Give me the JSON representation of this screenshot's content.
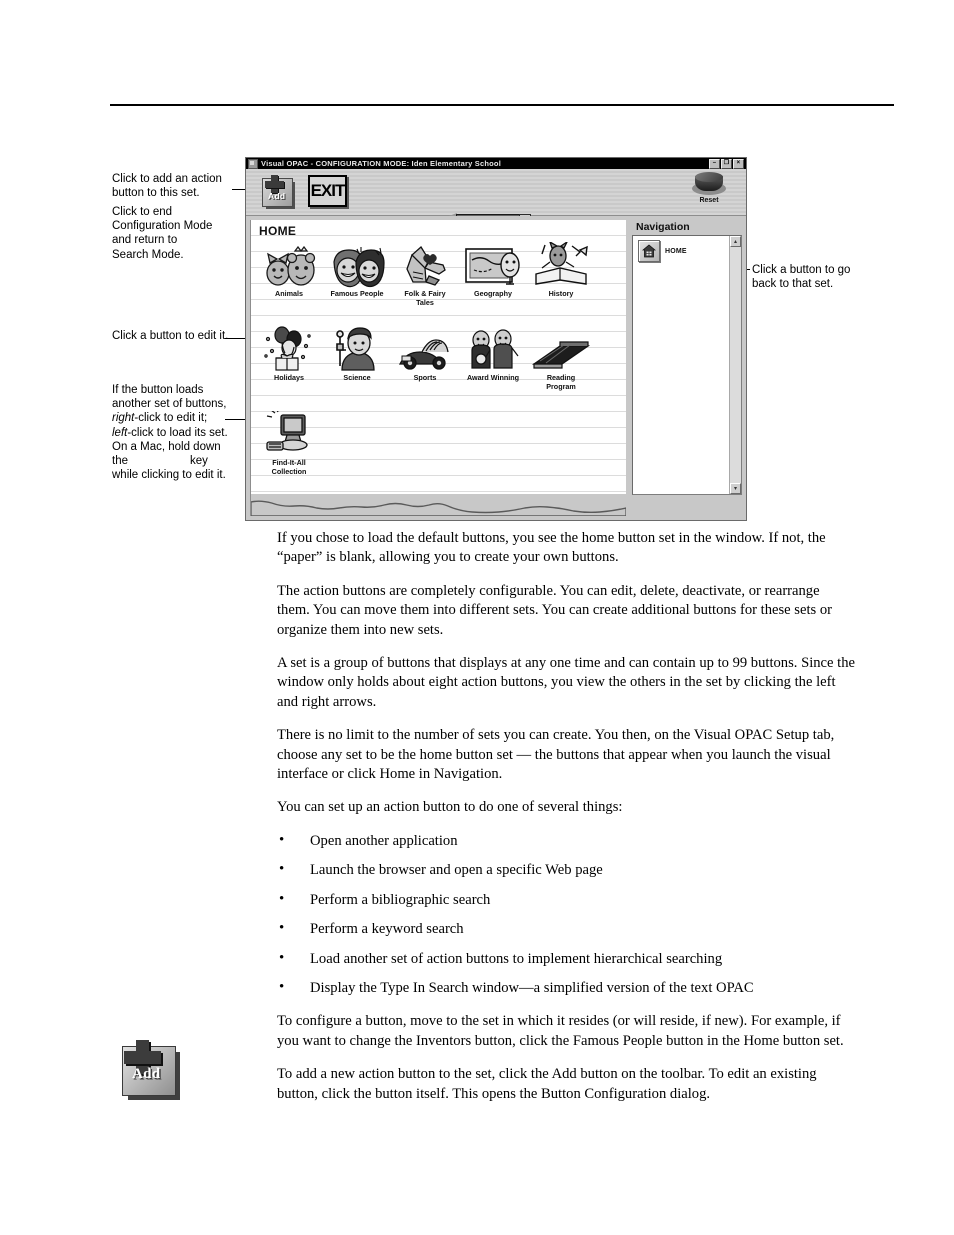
{
  "callouts": {
    "add_button": "Click to add an action button to this set.",
    "exit_button_l1": "Click to end",
    "exit_button_l2": "Configuration Mode",
    "exit_button_l3": "and return to",
    "exit_button_l4": "Search Mode.",
    "edit_button": "Click a button to edit it.",
    "loads_set_l1": "If the button loads",
    "loads_set_l2": "another set of buttons,",
    "loads_set_l3_a": "right",
    "loads_set_l3_b": "-click to edit it;",
    "loads_set_l4_a": "left",
    "loads_set_l4_b": "-click to load its set.",
    "loads_set_l5": "On a Mac, hold down",
    "loads_set_l6_a": "the",
    "loads_set_l6_b": "key",
    "loads_set_l7": "while clicking to edit it.",
    "navigation_button": "Click a button to go back to that set."
  },
  "window": {
    "title": "Visual OPAC - CONFIGURATION MODE: Iden Elementary School",
    "title_icon": "app-icon",
    "controls": [
      {
        "name": "minimize",
        "glyph": "–"
      },
      {
        "name": "restore",
        "glyph": "❐"
      },
      {
        "name": "close",
        "glyph": "×"
      }
    ],
    "toolbar": {
      "add_label": "Add",
      "exit_label": "EXIT",
      "reset_label": "Reset",
      "pencil_icon": "pencil-icon"
    },
    "paper": {
      "set_title": "HOME",
      "buttons": [
        {
          "label": "Animals",
          "icon": "animals-icon"
        },
        {
          "label": "Famous People",
          "icon": "famous-people-icon"
        },
        {
          "label": "Folk & Fairy\nTales",
          "icon": "folk-fairy-tales-icon"
        },
        {
          "label": "Geography",
          "icon": "geography-icon"
        },
        {
          "label": "History",
          "icon": "history-icon"
        },
        {
          "label": "Holidays",
          "icon": "holidays-icon"
        },
        {
          "label": "Science",
          "icon": "science-icon"
        },
        {
          "label": "Sports",
          "icon": "sports-icon"
        },
        {
          "label": "Award Winning",
          "icon": "award-winning-icon"
        },
        {
          "label": "Reading\nProgram",
          "icon": "reading-program-icon"
        },
        {
          "label": "Find-It-All\nCollection",
          "icon": "find-it-all-icon"
        }
      ]
    },
    "navigation": {
      "heading": "Navigation",
      "items": [
        {
          "label": "HOME",
          "icon": "home-icon"
        }
      ],
      "scroll_up_glyph": "▴",
      "scroll_down_glyph": "▾"
    }
  },
  "body": {
    "p1": "If you chose to load the default buttons, you see the home button set in the window. If not, the “paper” is blank, allowing you to create your own buttons.",
    "p2": "The action buttons are completely configurable. You can edit, delete, deactivate, or rearrange them. You can move them into different sets. You can create additional buttons for these sets or organize them into new sets.",
    "p3": "A set is a group of buttons that displays at any one time and can contain up to 99 buttons. Since the window only holds about eight action buttons, you view the others in the set by clicking the left and right arrows.",
    "p4": "There is no limit to the number of sets you can create. You then, on the Visual OPAC Setup tab, choose any set to be the home button set — the buttons that appear when you launch the visual interface or click Home in Navigation.",
    "p5": "You can set up an action button to do one of several things:",
    "bullets": [
      "Open another application",
      "Launch the browser and open a specific Web page",
      "Perform a bibliographic search",
      "Perform a keyword search",
      "Load another set of action buttons to implement hierarchical searching",
      "Display the Type In Search window—a simplified version of the text OPAC"
    ],
    "p6": "To configure a button, move to the set in which it resides (or will reside, if new). For example, if you want to change the Inventors button, click the Famous People button in the Home button set.",
    "p7": "To add a new action button to the set, click the Add button on the toolbar. To edit an existing button, click the button itself. This opens the Button Configuration dialog."
  },
  "figure_add_icon": {
    "label": "Add",
    "icon": "add-button-icon"
  }
}
